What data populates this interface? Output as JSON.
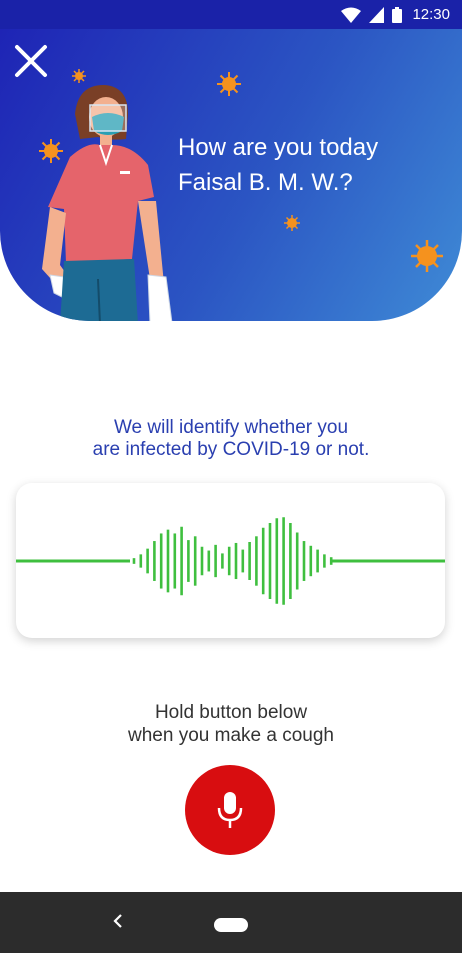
{
  "status_bar": {
    "time": "12:30",
    "icons": [
      "wifi-icon",
      "cell-signal-icon",
      "battery-icon"
    ]
  },
  "header": {
    "close_icon": "close-icon",
    "greeting_line1": "How are you today",
    "greeting_line2": "Faisal B. M. W.?",
    "illustration": "nurse-with-mask-illustration"
  },
  "main": {
    "subtitle_line1": "We will identify whether you",
    "subtitle_line2": "are infected by COVID-19 or not.",
    "waveform_icon": "audio-waveform",
    "instruction_line1": "Hold button below",
    "instruction_line2": "when you make a cough",
    "record_button_icon": "microphone-icon"
  },
  "nav_bar": {
    "back_icon": "back-chevron-icon",
    "home_icon": "home-pill-icon"
  },
  "colors": {
    "hero_gradient_start": "#1e24b5",
    "hero_gradient_end": "#3f8bd6",
    "accent_text": "#2a3fb0",
    "waveform": "#3fbf3f",
    "record_button": "#d80d10",
    "virus": "#f5921e"
  }
}
